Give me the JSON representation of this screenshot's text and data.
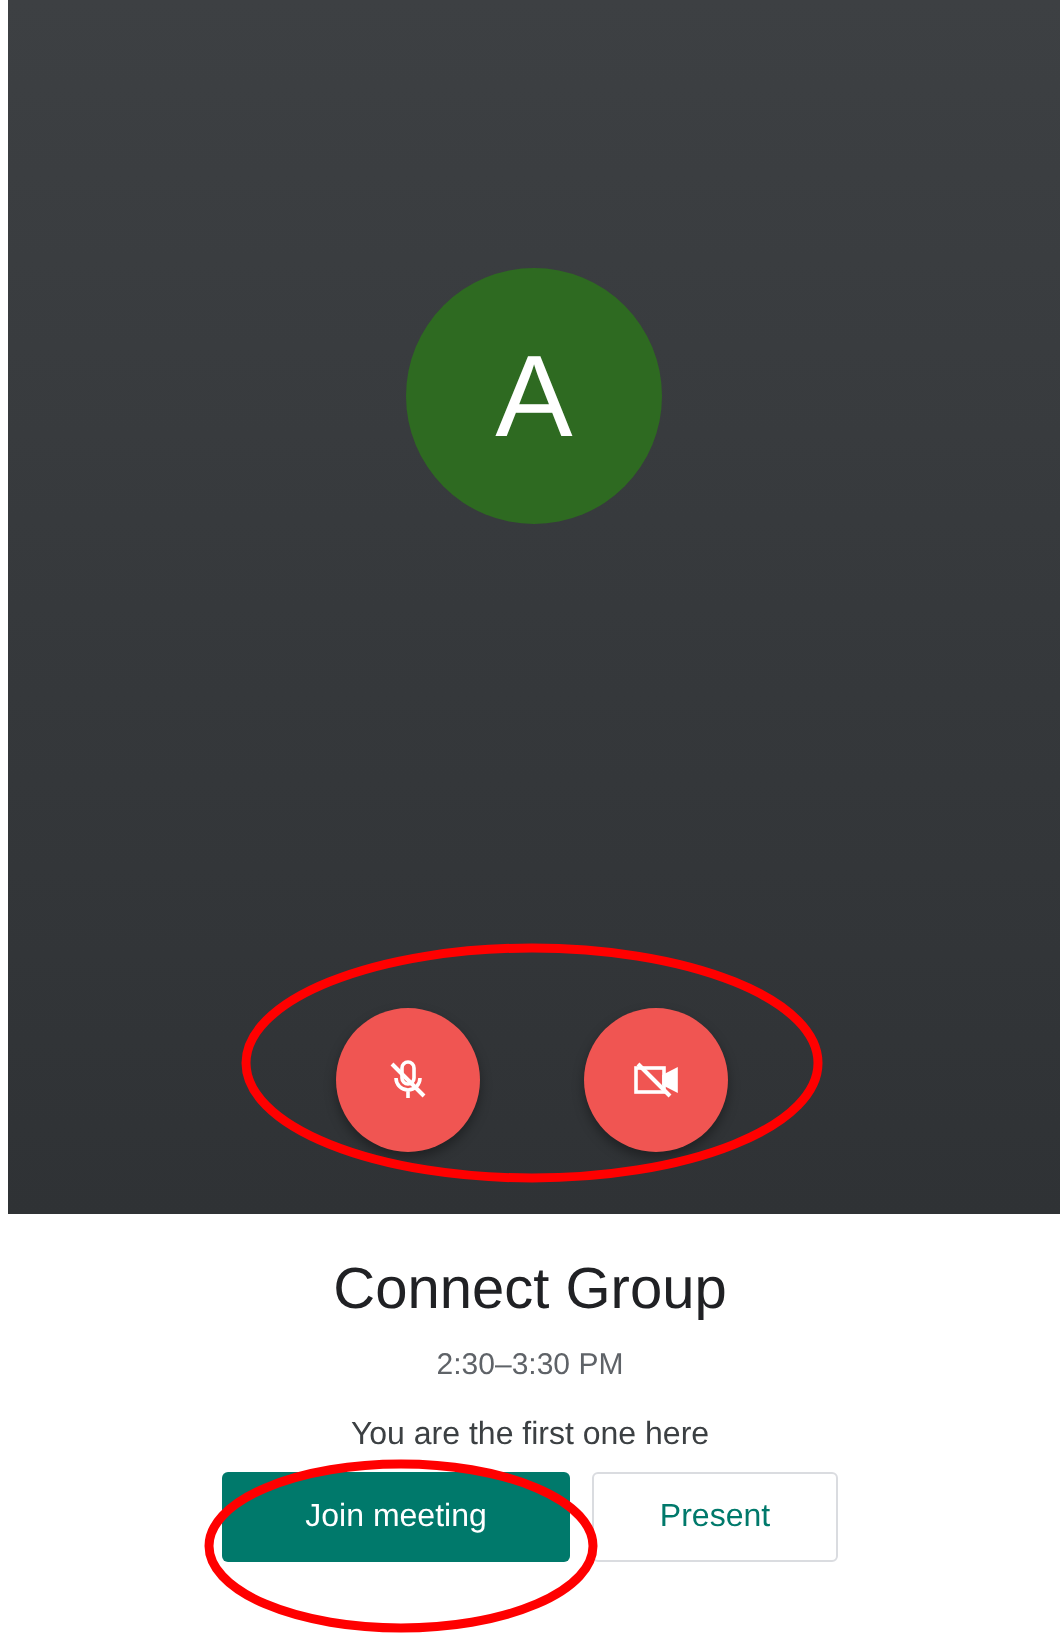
{
  "preview": {
    "avatar": {
      "initial": "A",
      "color": "#2e6a21"
    },
    "controls": [
      {
        "kind": "microphone",
        "on": false
      },
      {
        "kind": "camera",
        "on": false
      }
    ]
  },
  "meeting": {
    "title": "Connect Group",
    "time": "2:30–3:30 PM",
    "status": "You are the first one here"
  },
  "buttons": [
    {
      "kind": "primary",
      "label": "Join meeting"
    },
    {
      "kind": "secondary",
      "label": "Present"
    }
  ]
}
